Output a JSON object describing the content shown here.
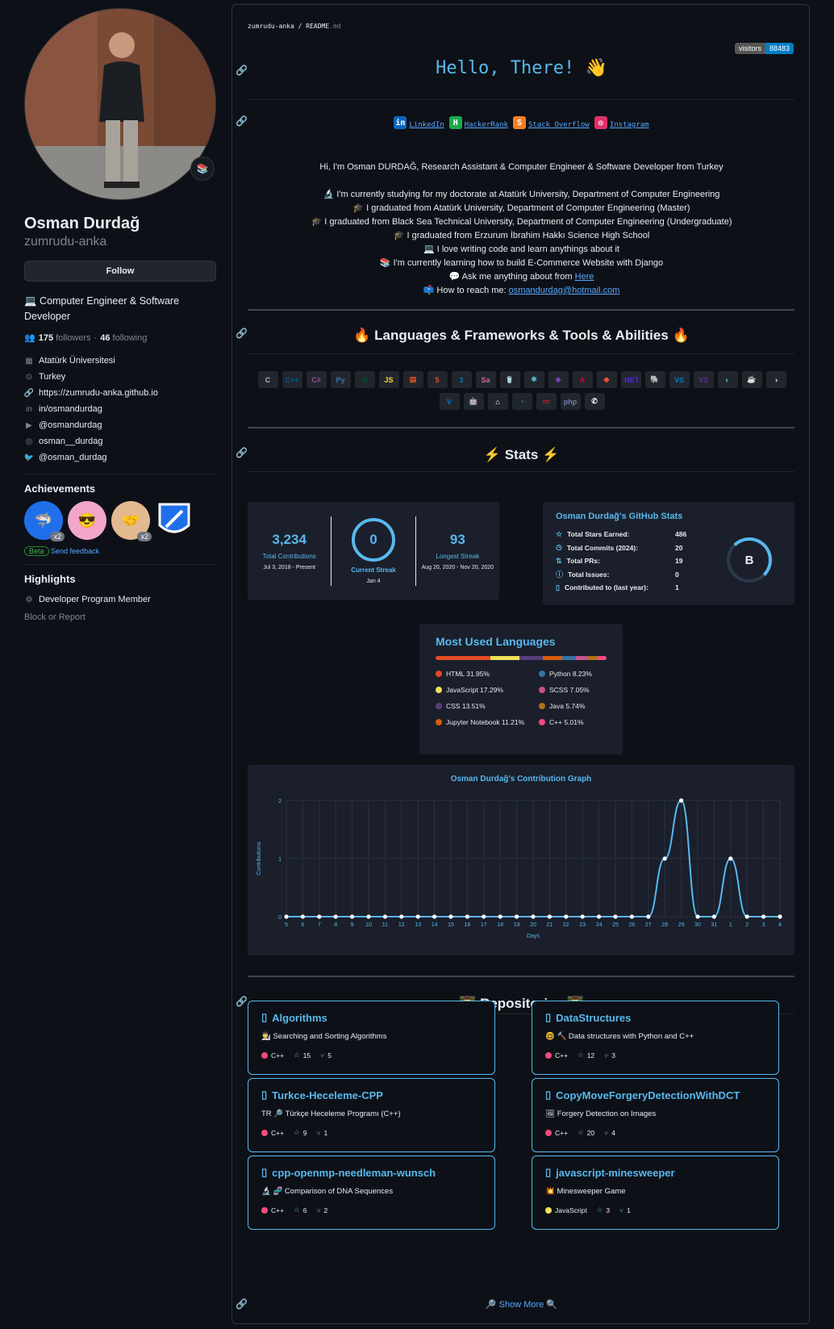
{
  "profile": {
    "name": "Osman Durdağ",
    "login": "zumrudu-anka",
    "follow": "Follow",
    "bio": "💻 Computer Engineer & Software Developer",
    "followers": "175",
    "followers_label": "followers",
    "following": "46",
    "following_label": "following",
    "status_emoji": "📚",
    "details": [
      {
        "icon": "organization-icon",
        "glyph": "▦",
        "text": "Atatürk Üniversitesi"
      },
      {
        "icon": "location-icon",
        "glyph": "⊙",
        "text": "Turkey"
      },
      {
        "icon": "link-icon",
        "glyph": "🔗",
        "text": "https://zumrudu-anka.github.io"
      },
      {
        "icon": "linkedin-icon",
        "glyph": "in",
        "text": "in/osmandurdag"
      },
      {
        "icon": "youtube-icon",
        "glyph": "▶",
        "text": "@osmandurdag"
      },
      {
        "icon": "instagram-icon",
        "glyph": "◎",
        "text": "osman__durdag"
      },
      {
        "icon": "twitter-icon",
        "glyph": "🐦",
        "text": "@osman_durdag"
      }
    ],
    "achievements_title": "Achievements",
    "achievement_x2": "x2",
    "beta": "Beta",
    "feedback": "Send feedback",
    "highlights_title": "Highlights",
    "highlight": "Developer Program Member",
    "block": "Block or Report"
  },
  "readme": {
    "crumb_repo": "zumrudu-anka",
    "crumb_sep": " / ",
    "crumb_file": "README",
    "crumb_ext": ".md",
    "visitors_label": "visitors",
    "visitors_count": "88483",
    "hello": "Hello, There! 👋",
    "social": [
      {
        "label": "LinkedIn",
        "glyph": "in",
        "color": "#0a66c2"
      },
      {
        "label": "HackerRank",
        "glyph": "H",
        "color": "#1ba94c"
      },
      {
        "label": "Stack Overflow",
        "glyph": "S",
        "color": "#f48024"
      },
      {
        "label": "Instagram",
        "glyph": "◎",
        "color": "#e1306c"
      }
    ],
    "intro": "Hi, I'm Osman DURDAĞ, Research Assistant & Computer Engineer & Software Developer from Turkey",
    "lines": [
      "🔬 I'm currently studying for my doctorate at Atatürk University, Department of Computer Engineering",
      "🎓 I graduated from Atatürk University, Department of Computer Engineering (Master)",
      "🎓 I graduated from Black Sea Technical University, Department of Computer Engineering (Undergraduate)",
      "🎓 I graduated from Erzurum İbrahim Hakkı Science High School",
      "💻 I love writing code and learn anythings about it",
      "📚 I'm currently learning how to build E-Commerce Website with Django"
    ],
    "ask_prefix": "💬 Ask me anything about from ",
    "ask_link": "Here",
    "reach_prefix": "📫 How to reach me: ",
    "reach_link": "osmandurdag@hotmail.com",
    "lang_title": "🔥 Languages & Frameworks & Tools & Abilities 🔥",
    "stats_title": "⚡ Stats ⚡",
    "repos_title": "👨‍💻 Repositories 👨‍💻",
    "show_more": "🔎 Show More 🔍",
    "tools": [
      {
        "g": "C",
        "c": "#a8b9cc"
      },
      {
        "g": "C++",
        "c": "#00599c"
      },
      {
        "g": "C#",
        "c": "#9b4f96"
      },
      {
        "g": "Py",
        "c": "#3776ab"
      },
      {
        "g": "dj",
        "c": "#0c4b33"
      },
      {
        "g": "JS",
        "c": "#f7df1e"
      },
      {
        "g": "▤",
        "c": "#e34f26"
      },
      {
        "g": "5",
        "c": "#e34f26"
      },
      {
        "g": "3",
        "c": "#1572b6"
      },
      {
        "g": "Sa",
        "c": "#cc6699"
      },
      {
        "g": "🥤",
        "c": "#c03"
      },
      {
        "g": "⚛",
        "c": "#61dafb"
      },
      {
        "g": "◈",
        "c": "#764abc"
      },
      {
        "g": "A",
        "c": "#dd0031"
      },
      {
        "g": "◆",
        "c": "#f05032"
      },
      {
        "g": ".NET",
        "c": "#512bd4"
      },
      {
        "g": "🐘",
        "c": "#336791"
      },
      {
        "g": "VS",
        "c": "#007acc"
      },
      {
        "g": "VS",
        "c": "#5c2d91"
      },
      {
        "g": "◐",
        "c": "#4db6ac"
      },
      {
        "g": "☕",
        "c": "#ea2d2e"
      },
      {
        "g": "◑",
        "c": "#bbb"
      },
      {
        "g": "V",
        "c": "#007acc"
      },
      {
        "g": "🤖",
        "c": "#3ddc84"
      },
      {
        "g": "⌂",
        "c": "#fff"
      },
      {
        "g": "◔",
        "c": "#4479a1"
      },
      {
        "g": "▭",
        "c": "#cc2927"
      },
      {
        "g": "php",
        "c": "#777bb4"
      },
      {
        "g": "✆",
        "c": "#fff"
      }
    ],
    "languages_title": "Most Used Languages"
  },
  "streak": {
    "total": "3,234",
    "total_label": "Total Contributions",
    "total_range": "Jul 3, 2018 - Present",
    "current": "0",
    "current_label": "Current Streak",
    "current_date": "Jan 4",
    "longest": "93",
    "longest_label": "Longest Streak",
    "longest_range": "Aug 20, 2020 - Nov 20, 2020"
  },
  "ghstats": {
    "title": "Osman Durdağ's GitHub Stats",
    "grade": "B",
    "rows": [
      {
        "label": "Total Stars Earned:",
        "value": "486",
        "icon": "☆"
      },
      {
        "label": "Total Commits (2024):",
        "value": "20",
        "icon": "◷"
      },
      {
        "label": "Total PRs:",
        "value": "19",
        "icon": "⇅"
      },
      {
        "label": "Total Issues:",
        "value": "0",
        "icon": "ⓘ"
      },
      {
        "label": "Contributed to (last year):",
        "value": "1",
        "icon": "▯"
      }
    ]
  },
  "languages": [
    {
      "name": "HTML 31.95%",
      "pct": 31.95,
      "color": "#e34c26"
    },
    {
      "name": "Python 8.23%",
      "pct": 8.23,
      "color": "#3572a5"
    },
    {
      "name": "JavaScript 17.29%",
      "pct": 17.29,
      "color": "#f1e05a"
    },
    {
      "name": "SCSS 7.05%",
      "pct": 7.05,
      "color": "#c6538c"
    },
    {
      "name": "CSS 13.51%",
      "pct": 13.51,
      "color": "#563d7c"
    },
    {
      "name": "Java 5.74%",
      "pct": 5.74,
      "color": "#b07219"
    },
    {
      "name": "Jupyter Notebook 11.21%",
      "pct": 11.21,
      "color": "#da5b0b"
    },
    {
      "name": "C++ 5.01%",
      "pct": 5.01,
      "color": "#f34b7d"
    }
  ],
  "chart_data": {
    "type": "line",
    "title": "Osman Durdağ's Contribution Graph",
    "xlabel": "Days",
    "ylabel": "Contributions",
    "ylim": [
      0,
      2
    ],
    "yticks": [
      "0",
      "1",
      "2"
    ],
    "x": [
      "5",
      "6",
      "7",
      "8",
      "9",
      "10",
      "11",
      "12",
      "13",
      "14",
      "15",
      "16",
      "17",
      "18",
      "19",
      "20",
      "21",
      "22",
      "23",
      "24",
      "25",
      "26",
      "27",
      "28",
      "29",
      "30",
      "31",
      "1",
      "2",
      "3",
      "4"
    ],
    "series": [
      {
        "values": [
          0,
          0,
          0,
          0,
          0,
          0,
          0,
          0,
          0,
          0,
          0,
          0,
          0,
          0,
          0,
          0,
          0,
          0,
          0,
          0,
          0,
          0,
          0,
          1,
          2,
          0,
          0,
          1,
          0,
          0,
          0
        ]
      }
    ],
    "grid": true,
    "color": "#58b8ee"
  },
  "repos": [
    {
      "name": "Algorithms",
      "desc": "👨‍🔬 Searching and Sorting Algorithms",
      "lang": "C++",
      "lang_color": "#f34b7d",
      "stars": "15",
      "forks": "5"
    },
    {
      "name": "DataStructures",
      "desc": "🤓 🔨 Data structures with Python and C++",
      "lang": "C++",
      "lang_color": "#f34b7d",
      "stars": "12",
      "forks": "3"
    },
    {
      "name": "Turkce-Heceleme-CPP",
      "desc": "TR 🔎 Türkçe Heceleme Programı (C++)",
      "lang": "C++",
      "lang_color": "#f34b7d",
      "stars": "9",
      "forks": "1"
    },
    {
      "name": "CopyMoveForgeryDetectionWithDCT",
      "desc": "🖼 Forgery Detection on Images",
      "lang": "C++",
      "lang_color": "#f34b7d",
      "stars": "20",
      "forks": "4"
    },
    {
      "name": "cpp-openmp-needleman-wunsch",
      "desc": "🔬 🧬 Comparison of DNA Sequences",
      "lang": "C++",
      "lang_color": "#f34b7d",
      "stars": "6",
      "forks": "2"
    },
    {
      "name": "javascript-minesweeper",
      "desc": "💥 Minesweeper Game",
      "lang": "JavaScript",
      "lang_color": "#f1e05a",
      "stars": "3",
      "forks": "1"
    }
  ]
}
